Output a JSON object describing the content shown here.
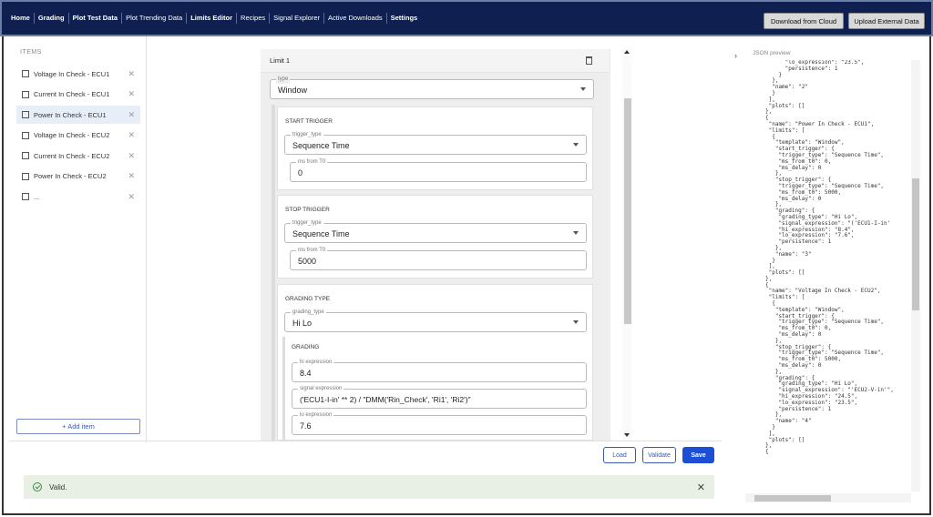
{
  "nav": {
    "items": [
      {
        "label": "Home",
        "bold": true
      },
      {
        "label": "Grading",
        "bold": true
      },
      {
        "label": "Plot Test Data",
        "bold": true
      },
      {
        "label": "Plot Trending Data",
        "bold": false
      },
      {
        "label": "Limits Editor",
        "bold": true
      },
      {
        "label": "Recipes",
        "bold": false
      },
      {
        "label": "Signal Explorer",
        "bold": false
      },
      {
        "label": "Active Downloads",
        "bold": false
      },
      {
        "label": "Settings",
        "bold": true
      }
    ],
    "download_label": "Download from Cloud",
    "upload_label": "Upload External Data"
  },
  "items_panel": {
    "title": "ITEMS",
    "items": [
      {
        "label": "Voltage In Check - ECU1"
      },
      {
        "label": "Current In Check - ECU1"
      },
      {
        "label": "Power In Check - ECU1"
      },
      {
        "label": "Voltage In Check - ECU2"
      },
      {
        "label": "Current In Check - ECU2"
      },
      {
        "label": "Power In Check - ECU2"
      },
      {
        "label": "..."
      }
    ],
    "selected_index": 2,
    "add_label": "+ Add item"
  },
  "editor": {
    "limit_title": "Limit 1",
    "type_label": "type",
    "type_value": "Window",
    "start_title": "START TRIGGER",
    "start_trigger_type_label": "trigger_type",
    "start_trigger_type_value": "Sequence Time",
    "start_ms_label": "ms from T0",
    "start_ms_value": "0",
    "stop_title": "STOP TRIGGER",
    "stop_trigger_type_label": "trigger_type",
    "stop_trigger_type_value": "Sequence Time",
    "stop_ms_label": "ms from T0",
    "stop_ms_value": "5000",
    "grading_type_title": "GRADING TYPE",
    "grading_type_label": "grading_type",
    "grading_type_value": "Hi Lo",
    "grading_title": "GRADING",
    "hi_label": "hi expression",
    "hi_value": "8.4",
    "signal_label": "signal expression",
    "signal_value": "('ECU1-I-in' ** 2) / \"DMM('Rin_Check', 'Ri1', 'Ri2')\"",
    "lo_label": "lo expression",
    "lo_value": "7.6"
  },
  "actions": {
    "load": "Load",
    "validate": "Validate",
    "save": "Save"
  },
  "status": {
    "text": "Valid."
  },
  "json_preview": {
    "title": "JSON preview",
    "text": "      \"lo_expression\": \"23.5\",\n      \"persistence\": 1\n    }\n  },\n  \"name\": \"2\"\n  }\n ],\n \"plots\": []\n},\n{\n \"name\": \"Power In Check - ECU1\",\n \"limits\": [\n  {\n   \"template\": \"Window\",\n   \"start_trigger\": {\n    \"trigger_type\": \"Sequence Time\",\n    \"ms_from_t0\": 0,\n    \"ms_delay\": 0\n   },\n   \"stop_trigger\": {\n    \"trigger_type\": \"Sequence Time\",\n    \"ms_from_t0\": 5000,\n    \"ms_delay\": 0\n   },\n   \"grading\": {\n    \"grading_type\": \"Hi Lo\",\n    \"signal_expression\": \"('ECU1-I-in'\n    \"hi_expression\": \"8.4\",\n    \"lo_expression\": \"7.6\",\n    \"persistence\": 1\n   },\n   \"name\": \"3\"\n  }\n ],\n \"plots\": []\n},\n{\n \"name\": \"Voltage In Check - ECU2\",\n \"limits\": [\n  {\n   \"template\": \"Window\",\n   \"start_trigger\": {\n    \"trigger_type\": \"Sequence Time\",\n    \"ms_from_t0\": 0,\n    \"ms_delay\": 0\n   },\n   \"stop_trigger\": {\n    \"trigger_type\": \"Sequence Time\",\n    \"ms_from_t0\": 5000,\n    \"ms_delay\": 0\n   },\n   \"grading\": {\n    \"grading_type\": \"Hi Lo\",\n    \"signal_expression\": \"'ECU2-V-in'\",\n    \"hi_expression\": \"24.5\",\n    \"lo_expression\": \"23.5\",\n    \"persistence\": 1\n   },\n   \"name\": \"4\"\n  }\n ],\n \"plots\": []\n},\n{"
  }
}
